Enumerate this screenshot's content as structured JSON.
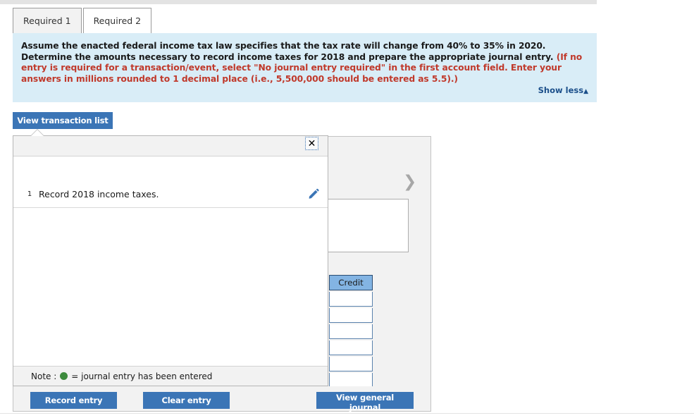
{
  "tabs": [
    {
      "label": "Required 1",
      "active": false
    },
    {
      "label": "Required 2",
      "active": true
    }
  ],
  "instruction": {
    "line1_black": "Assume the enacted federal income tax law specifies that the tax rate will change from 40% to 35% in 2020. Determine the amounts",
    "line2_black": "necessary to record income taxes for 2018 and prepare the appropriate journal entry. ",
    "line2_red": "(If no entry is required for a transaction/event,",
    "line3_red": "select \"No journal entry required\" in the first account field. Enter your answers in millions rounded to 1 decimal place (i.e., 5,500,000",
    "line4_red": "should be entered as 5.5).)",
    "show_less_label": "Show less",
    "show_less_caret": "▲"
  },
  "toolbar": {
    "view_transaction_list_label": "View transaction list"
  },
  "transaction_popover": {
    "close_label": "✕",
    "rows": [
      {
        "num": "1",
        "description": "Record 2018 income taxes."
      }
    ],
    "note_prefix": "Note :",
    "note_text": "= journal entry has been entered"
  },
  "journal": {
    "columns": [
      {
        "label": "Credit"
      }
    ],
    "credit_cells": [
      "",
      "",
      "",
      "",
      "",
      ""
    ],
    "next_chevron": "❯"
  },
  "actions": {
    "record_entry_label": "Record entry",
    "clear_entry_label": "Clear entry",
    "view_general_journal_label": "View general journal"
  },
  "colors": {
    "primary_button": "#3b75b6",
    "instruction_background": "#d9edf7",
    "instruction_red": "#c0392b",
    "credit_header": "#83b4e3",
    "note_dot_green": "#3d8b3d"
  }
}
